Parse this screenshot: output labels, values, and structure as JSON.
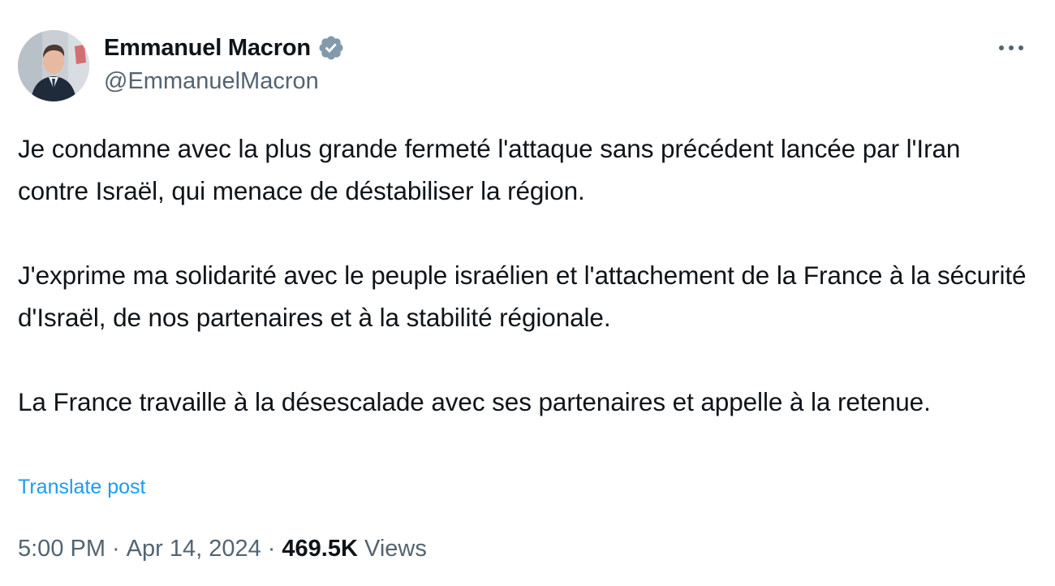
{
  "author": {
    "display_name": "Emmanuel Macron",
    "handle": "@EmmanuelMacron",
    "verified_icon": "verified-badge-icon",
    "verified_color": "#829aab"
  },
  "post": {
    "paragraphs": [
      "Je condamne avec la plus grande fermeté l'attaque sans précédent lancée par l'Iran contre Israël, qui menace de déstabiliser la région.",
      "J'exprime ma solidarité avec le peuple israélien et l'attachement de la France à la sécurité d'Israël, de nos partenaires et à la stabilité régionale.",
      "La France travaille à la désescalade avec ses partenaires et appelle à la retenue."
    ],
    "translate_label": "Translate post"
  },
  "meta": {
    "time": "5:00 PM",
    "separator": "·",
    "date": "Apr 14, 2024",
    "views_count": "469.5K",
    "views_label": "Views"
  },
  "more_icon": "more-options-icon",
  "colors": {
    "text": "#0f1419",
    "secondary": "#536471",
    "link": "#1d9bf0"
  }
}
